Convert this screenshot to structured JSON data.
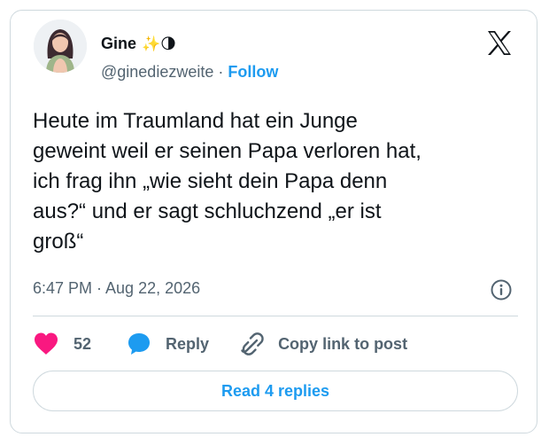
{
  "author": {
    "name": "Gine",
    "emojis": "✨🌗",
    "handle": "@ginediezweite",
    "separator": "·",
    "follow_label": "Follow"
  },
  "tweet": {
    "text": "Heute im Traumland hat ein Junge\ngeweint weil er seinen Papa verloren hat,\nich frag ihn „wie sieht dein Papa denn\naus?“ und er sagt schluchzend „er ist\ngroß“",
    "timestamp": "6:47 PM · Aug 22, 2026"
  },
  "actions": {
    "like_count": "52",
    "reply_label": "Reply",
    "copy_link_label": "Copy link to post"
  },
  "footer": {
    "read_replies_label": "Read 4 replies"
  },
  "colors": {
    "accent": "#1d9bf0",
    "like": "#f91880",
    "muted_text": "#536471",
    "border": "#cfd9de"
  },
  "icons": [
    "x-logo-icon",
    "info-icon",
    "heart-icon",
    "reply-bubble-icon",
    "link-icon"
  ]
}
